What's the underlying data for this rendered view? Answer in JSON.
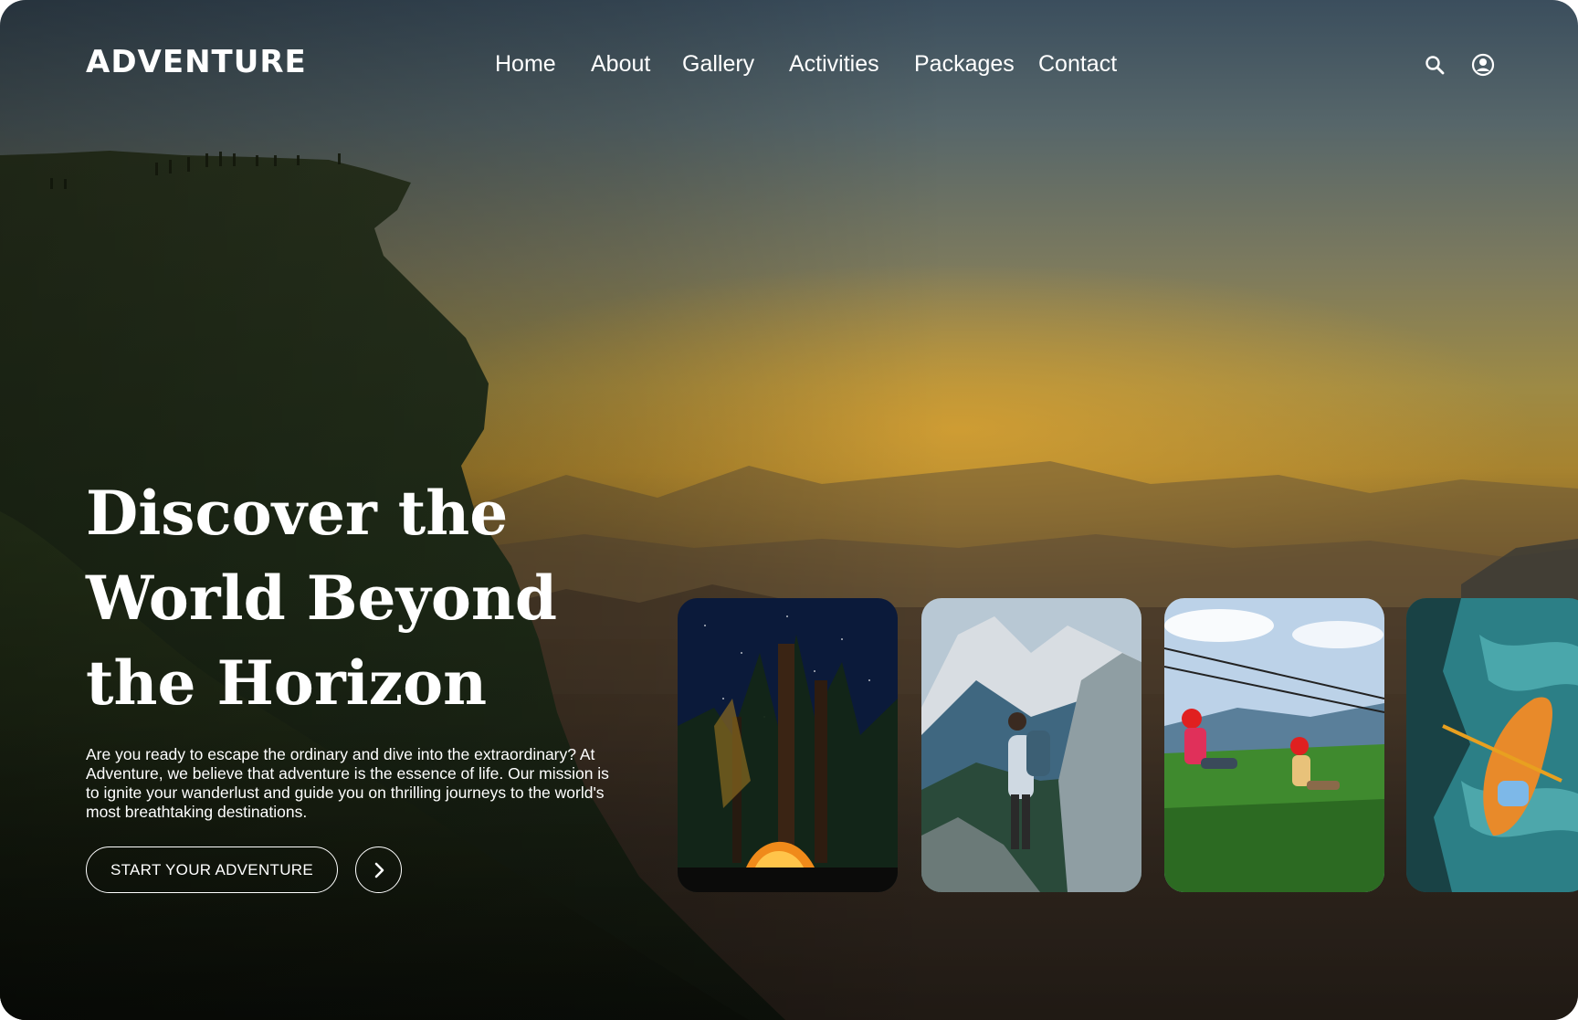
{
  "header": {
    "logo": "ADVENTURE",
    "nav": [
      {
        "label": "Home"
      },
      {
        "label": "About"
      },
      {
        "label": "Gallery"
      },
      {
        "label": "Activities"
      },
      {
        "label": "Packages"
      },
      {
        "label": "Contact"
      }
    ],
    "icons": [
      "search-icon",
      "account-icon"
    ]
  },
  "hero": {
    "title_lines": [
      "Discover the",
      "World Beyond",
      "the Horizon"
    ],
    "description": "Are you ready to escape the ordinary and dive into the extraordinary? At Adventure, we believe that adventure is the essence of life. Our mission is to ignite your wanderlust and guide you on thrilling journeys to the world's most breathtaking destinations.",
    "cta_label": "START YOUR ADVENTURE"
  },
  "gallery": {
    "cards": [
      {
        "image": "camping-tent-night"
      },
      {
        "image": "hiker-mountains"
      },
      {
        "image": "zipline"
      },
      {
        "image": "kayak-rapids"
      }
    ]
  },
  "colors": {
    "text": "#ffffff",
    "sky_top": "#3b4e5d",
    "sunset": "#a7832f"
  }
}
